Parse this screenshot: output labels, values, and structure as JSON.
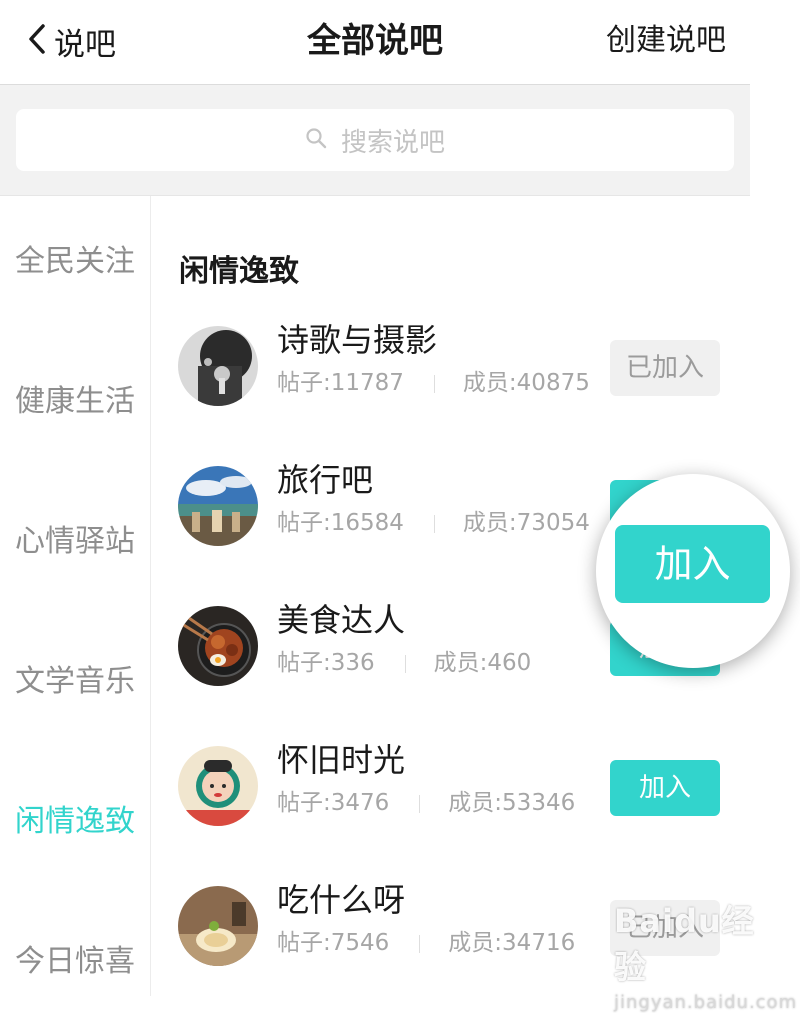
{
  "header": {
    "back_label": "说吧",
    "title": "全部说吧",
    "create_label": "创建说吧"
  },
  "search": {
    "placeholder": "搜索说吧"
  },
  "sidebar": {
    "items": [
      {
        "label": "全民关注",
        "active": false
      },
      {
        "label": "健康生活",
        "active": false
      },
      {
        "label": "心情驿站",
        "active": false
      },
      {
        "label": "文学音乐",
        "active": false
      },
      {
        "label": "闲情逸致",
        "active": true
      },
      {
        "label": "今日惊喜",
        "active": false
      }
    ]
  },
  "section": {
    "title": "闲情逸致"
  },
  "groups": [
    {
      "name": "诗歌与摄影",
      "posts": "帖子:11787",
      "members": "成员:40875",
      "button": "已加入",
      "state": "joined",
      "avatar_icon": "silhouette-photo-icon"
    },
    {
      "name": "旅行吧",
      "posts": "帖子:16584",
      "members": "成员:73054",
      "button": "加入",
      "state": "join",
      "avatar_icon": "travel-landscape-icon"
    },
    {
      "name": "美食达人",
      "posts": "帖子:336",
      "members": "成员:460",
      "button": "加入",
      "state": "join",
      "avatar_icon": "food-bowl-icon"
    },
    {
      "name": "怀旧时光",
      "posts": "帖子:3476",
      "members": "成员:53346",
      "button": "加入",
      "state": "join",
      "avatar_icon": "retro-poster-icon"
    },
    {
      "name": "吃什么呀",
      "posts": "帖子:7546",
      "members": "成员:34716",
      "button": "已加入",
      "state": "joined",
      "avatar_icon": "dessert-icon"
    }
  ],
  "magnifier": {
    "button_label": "加入"
  },
  "watermark": {
    "brand": "Baidu经验",
    "sub": "jingyan.baidu.com"
  },
  "colors": {
    "accent": "#32d4cc",
    "joined_bg": "#f0f0f0",
    "muted_text": "#a6a6a6"
  }
}
